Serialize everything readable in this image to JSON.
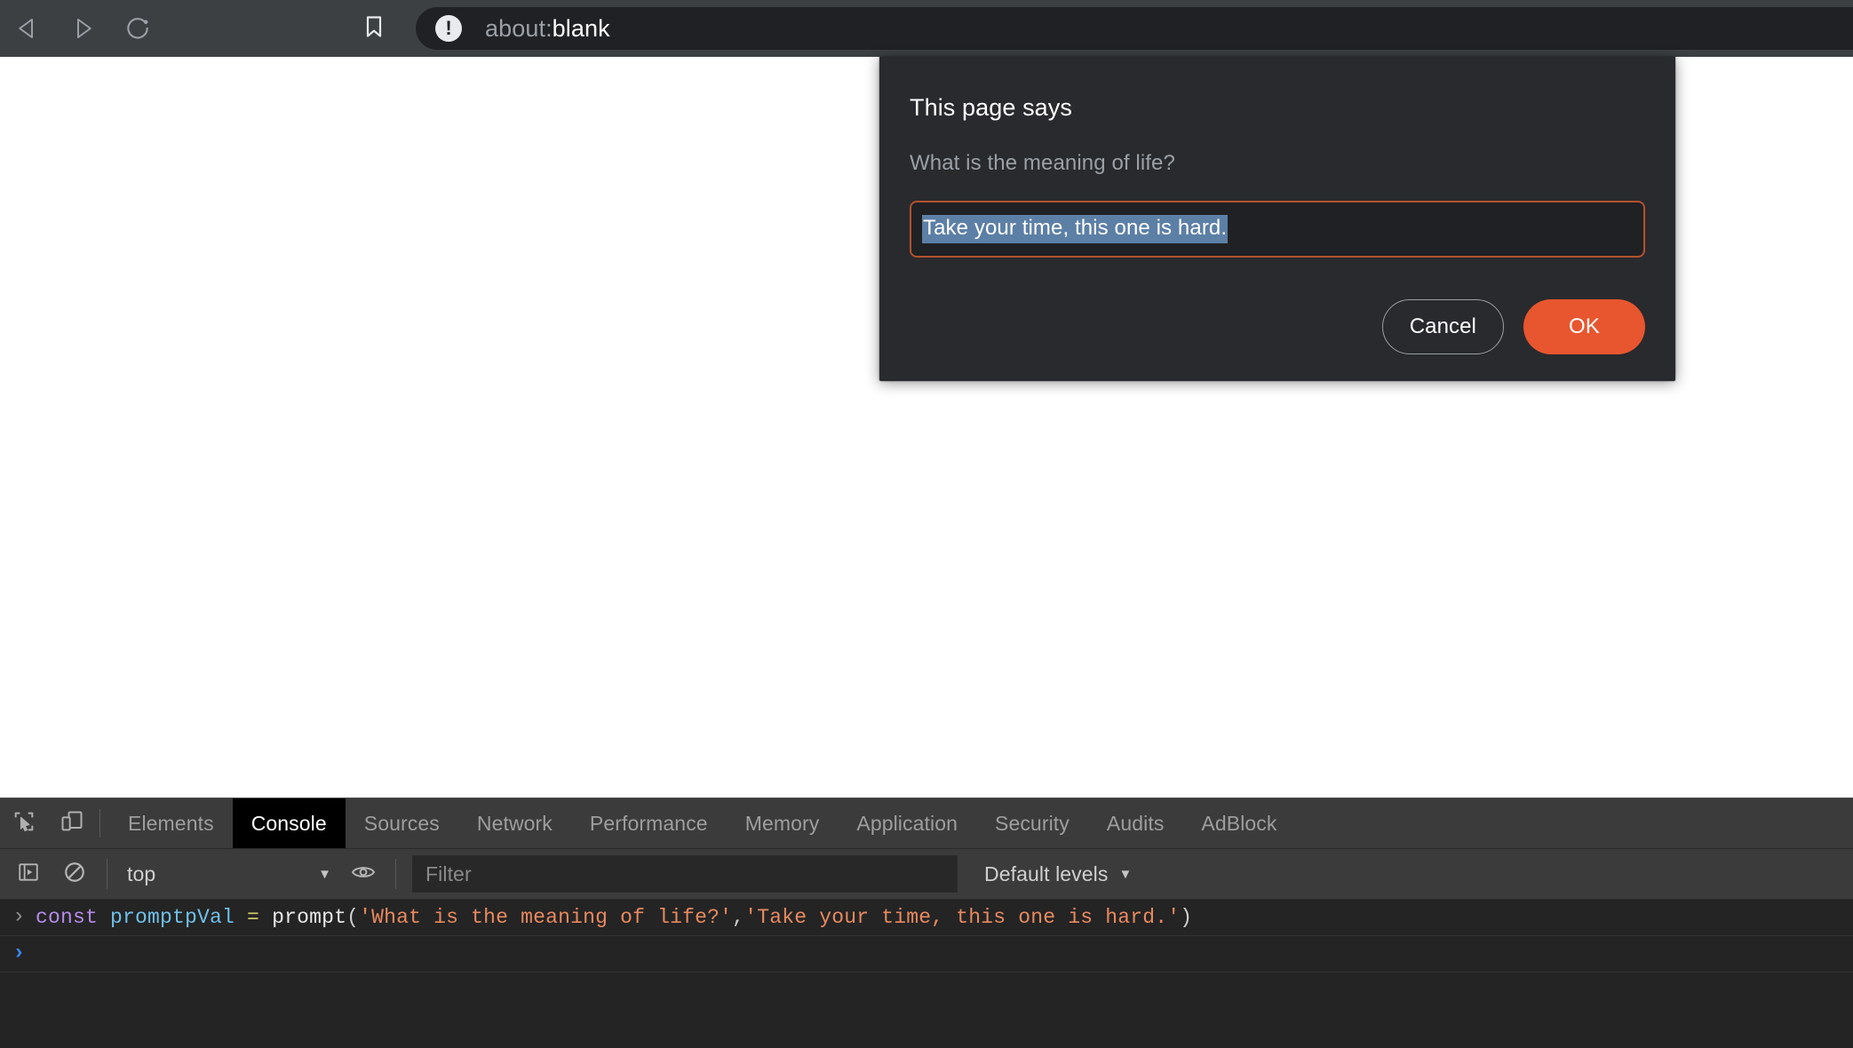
{
  "browser": {
    "nav": {
      "back_icon": "back-triangle-icon",
      "forward_icon": "forward-triangle-icon",
      "reload_icon": "reload-circular-arrow-icon",
      "bookmark_icon": "bookmark-icon"
    },
    "omnibox": {
      "security_icon": "not-secure-exclamation-icon",
      "scheme": "about:",
      "host": "blank",
      "full_url": "about:blank"
    }
  },
  "dialog": {
    "title": "This page says",
    "message": "What is the meaning of life?",
    "input_value": "Take your time, this one is hard.",
    "cancel_label": "Cancel",
    "ok_label": "OK",
    "colors": {
      "background": "#292a2d",
      "input_background": "#202124",
      "input_border": "#b4512e",
      "selection": "#5c7fa6",
      "ok_button": "#e8562f",
      "message_text": "#9aa0a6"
    }
  },
  "devtools": {
    "left_icons": [
      {
        "name": "inspect-element-icon"
      },
      {
        "name": "device-toolbar-icon"
      }
    ],
    "tabs": [
      {
        "label": "Elements",
        "active": false
      },
      {
        "label": "Console",
        "active": true
      },
      {
        "label": "Sources",
        "active": false
      },
      {
        "label": "Network",
        "active": false
      },
      {
        "label": "Performance",
        "active": false
      },
      {
        "label": "Memory",
        "active": false
      },
      {
        "label": "Application",
        "active": false
      },
      {
        "label": "Security",
        "active": false
      },
      {
        "label": "Audits",
        "active": false
      },
      {
        "label": "AdBlock",
        "active": false
      }
    ],
    "console_toolbar": {
      "sidebar_toggle_icon": "console-sidebar-toggle-icon",
      "clear_icon": "clear-console-no-entry-icon",
      "context_value": "top",
      "context_arrow": "▼",
      "eye_icon": "live-expression-eye-icon",
      "filter_placeholder": "Filter",
      "levels_value": "Default levels",
      "levels_arrow": "▼"
    },
    "console_rows": [
      {
        "prompt": "›",
        "tokens": [
          {
            "text": "const ",
            "type": "kw"
          },
          {
            "text": "promptpVal ",
            "type": "var"
          },
          {
            "text": "= ",
            "type": "op"
          },
          {
            "text": "prompt",
            "type": "fn"
          },
          {
            "text": "(",
            "type": "punct"
          },
          {
            "text": "'What is the meaning of life?'",
            "type": "str"
          },
          {
            "text": ",",
            "type": "punct"
          },
          {
            "text": "'Take your time, this one is hard.'",
            "type": "str"
          },
          {
            "text": ")",
            "type": "punct"
          }
        ],
        "code_text": "const promptpVal = prompt('What is the meaning of life?','Take your time, this one is hard.')"
      }
    ],
    "console_input": {
      "prompt": "›",
      "value": ""
    }
  }
}
